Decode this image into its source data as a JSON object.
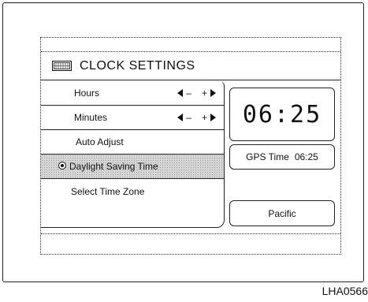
{
  "title": "CLOCK SETTINGS",
  "title_icon": "keyboard-icon",
  "menu": {
    "hours": {
      "label": "Hours",
      "minus": "–",
      "plus": "+"
    },
    "minutes": {
      "label": "Minutes",
      "minus": "–",
      "plus": "+"
    },
    "auto_adjust": {
      "label": "Auto Adjust"
    },
    "daylight_saving": {
      "label": "Daylight Saving Time",
      "selected": true
    },
    "time_zone": {
      "label": "Select Time Zone"
    }
  },
  "clock": {
    "time": "06:25"
  },
  "gps": {
    "label": "GPS Time",
    "time": "06:25"
  },
  "time_zone_value": "Pacific",
  "figure_id": "LHA0566"
}
